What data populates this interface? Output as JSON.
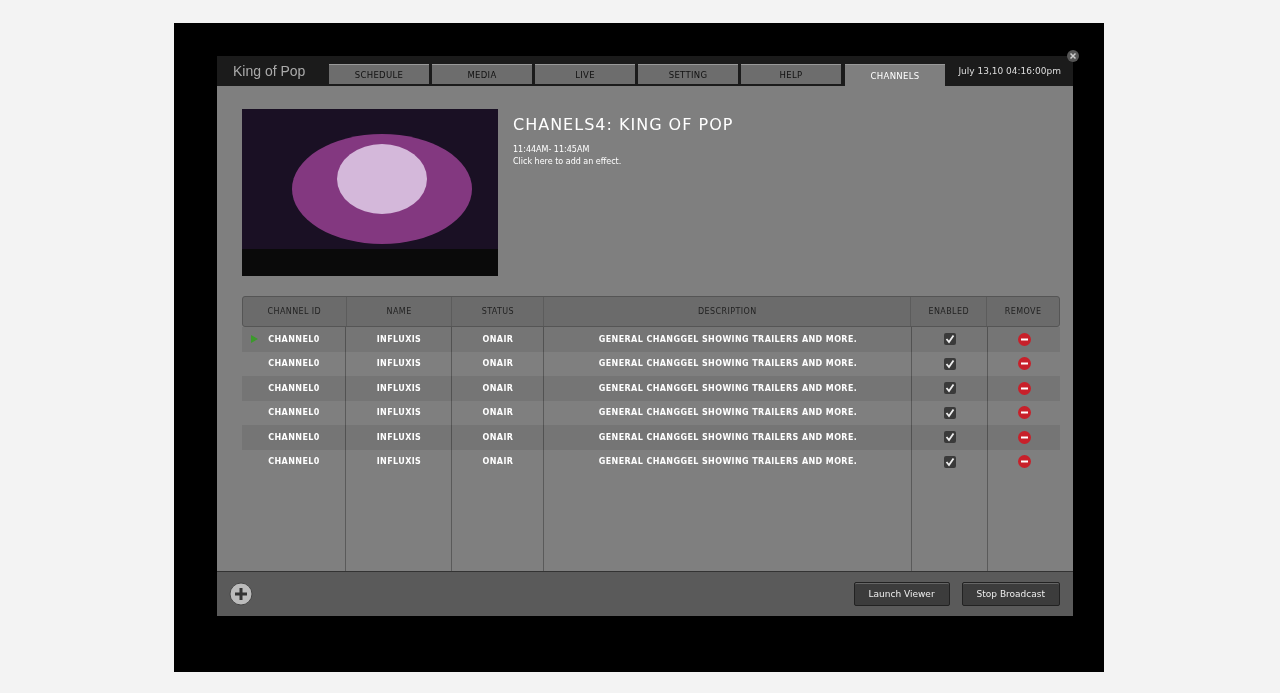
{
  "app": {
    "title": "King of Pop",
    "datetime": "July 13,10 04:16:00pm"
  },
  "tabs": [
    {
      "label": "SCHEDULE",
      "selected": false
    },
    {
      "label": "MEDIA",
      "selected": false
    },
    {
      "label": "LIVE",
      "selected": false
    },
    {
      "label": "SETTING",
      "selected": false
    },
    {
      "label": "HELP",
      "selected": false
    },
    {
      "label": "CHANNELS",
      "selected": true
    }
  ],
  "channel": {
    "title": "CHANELS4: KING OF POP",
    "time": "11:44AM- 11:45AM",
    "effect_link": "Click here to add an effect."
  },
  "table": {
    "columns": [
      "CHANNEL ID",
      "NAME",
      "STATUS",
      "DESCRIPTION",
      "ENABLED",
      "REMOVE"
    ],
    "rows": [
      {
        "id": "CHANNEL0",
        "name": "INFLUXIS",
        "status": "ONAIR",
        "description": "GENERAL CHANGGEL SHOWING TRAILERS AND MORE.",
        "enabled": true,
        "selected": true
      },
      {
        "id": "CHANNEL0",
        "name": "INFLUXIS",
        "status": "ONAIR",
        "description": "GENERAL CHANGGEL SHOWING TRAILERS AND MORE.",
        "enabled": true,
        "selected": false
      },
      {
        "id": "CHANNEL0",
        "name": "INFLUXIS",
        "status": "ONAIR",
        "description": "GENERAL CHANGGEL SHOWING TRAILERS AND MORE.",
        "enabled": true,
        "selected": false
      },
      {
        "id": "CHANNEL0",
        "name": "INFLUXIS",
        "status": "ONAIR",
        "description": "GENERAL CHANGGEL SHOWING TRAILERS AND MORE.",
        "enabled": true,
        "selected": false
      },
      {
        "id": "CHANNEL0",
        "name": "INFLUXIS",
        "status": "ONAIR",
        "description": "GENERAL CHANGGEL SHOWING TRAILERS AND MORE.",
        "enabled": true,
        "selected": false
      },
      {
        "id": "CHANNEL0",
        "name": "INFLUXIS",
        "status": "ONAIR",
        "description": "GENERAL CHANGGEL SHOWING TRAILERS AND MORE.",
        "enabled": true,
        "selected": false
      }
    ]
  },
  "buttons": [
    "Launch Viewer",
    "Stop Broadcast"
  ]
}
